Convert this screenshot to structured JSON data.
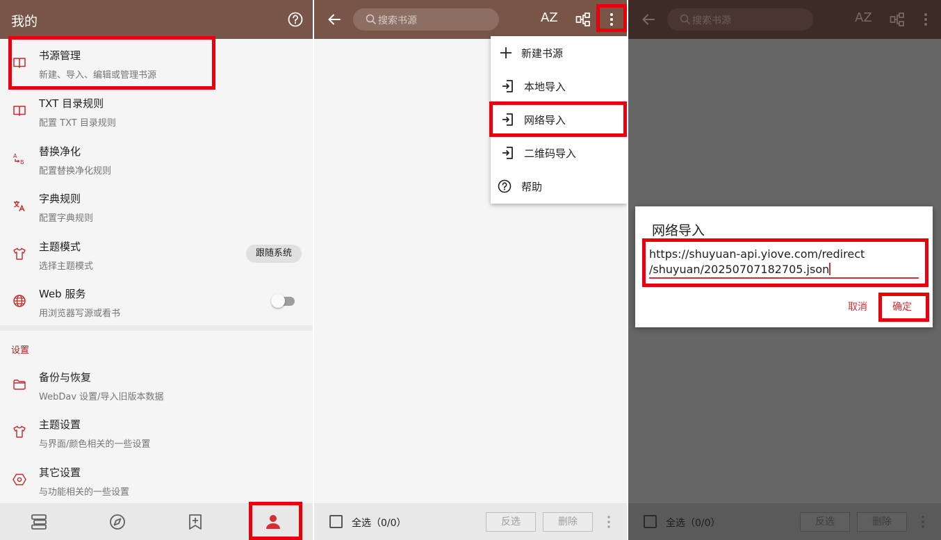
{
  "colors": {
    "accent": "#795548",
    "primary_text": "#212121",
    "secondary_text": "#757575",
    "highlight": "#e8000d",
    "dialog_accent": "#d32f2f"
  },
  "my_page": {
    "title": "我的",
    "help_icon": "help-circle-icon",
    "items": [
      {
        "title": "书源管理",
        "subtitle": "新建、导入、编辑或管理书源",
        "icon": "book-open-icon"
      },
      {
        "title": "TXT 目录规则",
        "subtitle": "配置 TXT 目录规则",
        "icon": "book-open-icon"
      },
      {
        "title": "替换净化",
        "subtitle": "配置替换净化规则",
        "icon": "replace-ab-icon"
      },
      {
        "title": "字典规则",
        "subtitle": "配置字典规则",
        "icon": "translate-icon"
      },
      {
        "title": "主题模式",
        "subtitle": "选择主题模式",
        "icon": "tshirt-icon",
        "value": "跟随系统"
      },
      {
        "title": "Web 服务",
        "subtitle": "用浏览器写源或看书",
        "icon": "globe-icon",
        "toggle_on": false
      }
    ],
    "section_label": "设置",
    "settings": [
      {
        "title": "备份与恢复",
        "subtitle": "WebDav 设置/导入旧版本数据",
        "icon": "folder-icon"
      },
      {
        "title": "主题设置",
        "subtitle": "与界面/颜色相关的一些设置",
        "icon": "tshirt-icon"
      },
      {
        "title": "其它设置",
        "subtitle": "与功能相关的一些设置",
        "icon": "hexagon-settings-icon"
      }
    ],
    "bottom_nav": [
      "bookshelf-icon",
      "compass-icon",
      "bookmark-add-icon",
      "person-icon"
    ]
  },
  "source_manager": {
    "search_placeholder": "搜索书源",
    "sort_label": "AZ",
    "menu": [
      {
        "label": "新建书源",
        "icon": "plus-icon"
      },
      {
        "label": "本地导入",
        "icon": "import-icon"
      },
      {
        "label": "网络导入",
        "icon": "import-icon"
      },
      {
        "label": "二维码导入",
        "icon": "import-icon"
      },
      {
        "label": "帮助",
        "icon": "help-circle-icon"
      }
    ],
    "select_all": "全选（0/0）",
    "invert_label": "反选",
    "delete_label": "删除"
  },
  "import_dialog": {
    "title": "网络导入",
    "url_line1": "https://shuyuan-api.yiove.com/redirect",
    "url_line2": "/shuyuan/20250707182705.json",
    "cancel": "取消",
    "confirm": "确定"
  }
}
